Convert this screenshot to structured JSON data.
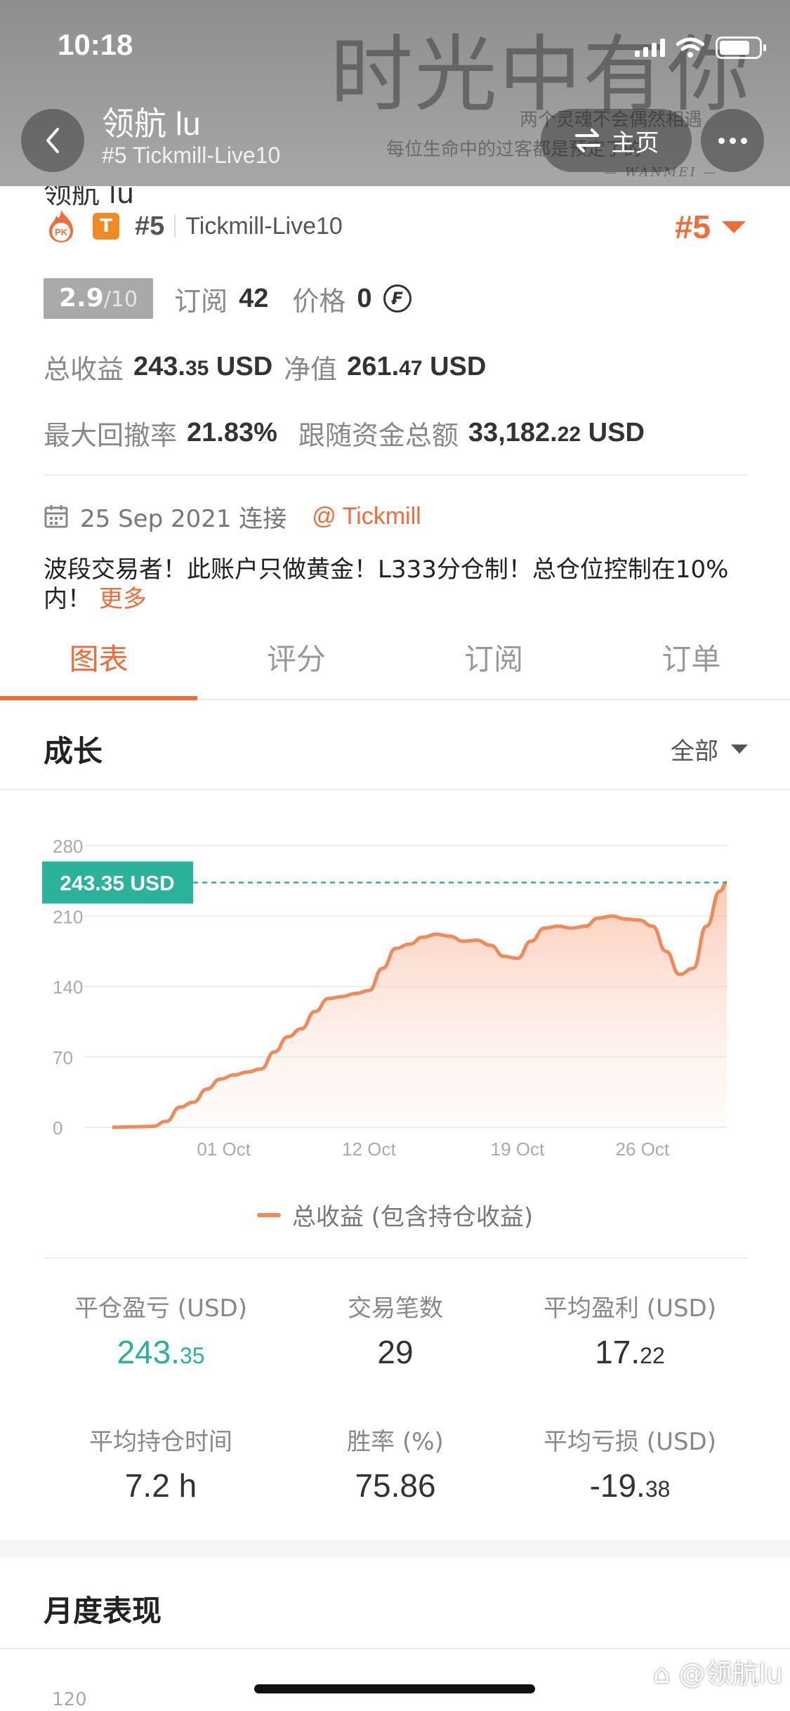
{
  "status_bar": {
    "time": "10:18"
  },
  "header": {
    "title": "领航 lu",
    "subtitle": "#5 Tickmill-Live10",
    "home_label": "主页",
    "bg_big": "时光中有你",
    "bg_line1": "两个灵魂不会偶然相遇",
    "bg_line2": "每位生命中的过客都是预定了的",
    "bg_line3": "— WANMEI —"
  },
  "profile": {
    "cut_title": "领航 lu",
    "pk_label": "PK",
    "badge_t": "T",
    "rank": "#5",
    "server": "Tickmill-Live10",
    "rank_right": "#5",
    "score_main": "2.9",
    "score_suffix": "/10",
    "subscribe_label": "订阅",
    "subscribe_value": "42",
    "price_label": "价格",
    "price_value": "0",
    "price_icon": "₣",
    "total_profit_label": "总收益",
    "total_profit_int": "243.",
    "total_profit_dec": "35",
    "total_profit_unit": "USD",
    "equity_label": "净值",
    "equity_int": "261.",
    "equity_dec": "47",
    "equity_unit": "USD",
    "drawdown_label": "最大回撤率",
    "drawdown_value": "21.83%",
    "follow_label": "跟随资金总额",
    "follow_int": "33,182.",
    "follow_dec": "22",
    "follow_unit": "USD",
    "date_text": "25 Sep 2021 连接",
    "broker_link": "@ Tickmill",
    "description": "波段交易者！此账户只做黄金！L333分仓制！总仓位控制在10%内！",
    "more_link": "更多"
  },
  "tabs": [
    {
      "label": "图表",
      "active": true
    },
    {
      "label": "评分",
      "active": false
    },
    {
      "label": "订阅",
      "active": false
    },
    {
      "label": "订单",
      "active": false
    }
  ],
  "growth": {
    "title": "成长",
    "filter_label": "全部"
  },
  "chart_data": {
    "type": "area",
    "title": "",
    "ylim": [
      0,
      280
    ],
    "y_ticks": [
      "280",
      "210",
      "140",
      "70",
      "0"
    ],
    "x_tick_labels": [
      "01 Oct",
      "12 Oct",
      "19 Oct",
      "26 Oct"
    ],
    "current_label": "243.35 USD",
    "current_value": 243.35,
    "series": [
      {
        "name": "总收益 (包含持仓收益)",
        "color": "#f08a5a",
        "points": [
          [
            0,
            0
          ],
          [
            3,
            0.5
          ],
          [
            6,
            1
          ],
          [
            8,
            6
          ],
          [
            10,
            20
          ],
          [
            12,
            25
          ],
          [
            14,
            38
          ],
          [
            16,
            48
          ],
          [
            18,
            52
          ],
          [
            20,
            55
          ],
          [
            22,
            58
          ],
          [
            24,
            75
          ],
          [
            26,
            90
          ],
          [
            28,
            98
          ],
          [
            30,
            115
          ],
          [
            32,
            128
          ],
          [
            34,
            130
          ],
          [
            36,
            133
          ],
          [
            38,
            136
          ],
          [
            40,
            158
          ],
          [
            42,
            178
          ],
          [
            44,
            182
          ],
          [
            46,
            189
          ],
          [
            48,
            192
          ],
          [
            50,
            190
          ],
          [
            52,
            185
          ],
          [
            54,
            186
          ],
          [
            56,
            181
          ],
          [
            58,
            170
          ],
          [
            60,
            168
          ],
          [
            62,
            185
          ],
          [
            64,
            198
          ],
          [
            66,
            200
          ],
          [
            68,
            198
          ],
          [
            70,
            200
          ],
          [
            72,
            208
          ],
          [
            74,
            210
          ],
          [
            76,
            207
          ],
          [
            78,
            206
          ],
          [
            80,
            200
          ],
          [
            82,
            175
          ],
          [
            84,
            152
          ],
          [
            86,
            158
          ],
          [
            88,
            200
          ],
          [
            90,
            235
          ],
          [
            91,
            243.35
          ]
        ]
      }
    ]
  },
  "legend_label": "总收益 (包含持仓收益)",
  "stats": [
    {
      "label": "平仓盈亏 (USD)",
      "int": "243.",
      "dec": "35",
      "green": true
    },
    {
      "label": "交易笔数",
      "int": "29",
      "dec": "",
      "green": false
    },
    {
      "label": "平均盈利 (USD)",
      "int": "17.",
      "dec": "22",
      "green": false
    },
    {
      "label": "平均持仓时间",
      "int": "7.2 h",
      "dec": "",
      "green": false
    },
    {
      "label": "胜率 (%)",
      "int": "75.86",
      "dec": "",
      "green": false
    },
    {
      "label": "平均亏损 (USD)",
      "int": "-19.",
      "dec": "38",
      "green": false
    }
  ],
  "monthly": {
    "title": "月度表现",
    "first_tick": "120"
  },
  "watermark": "⌂ @领航lu"
}
